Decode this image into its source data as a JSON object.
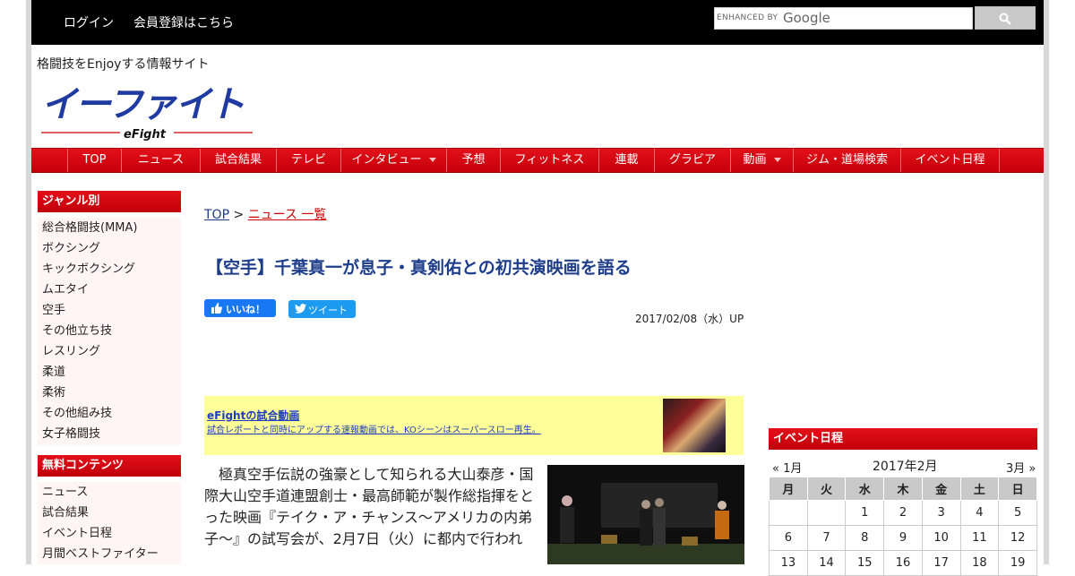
{
  "topbar": {
    "login": "ログイン",
    "register": "会員登録はこちら",
    "search_label": "ENHANCED BY",
    "search_brand": "Google"
  },
  "header": {
    "tagline": "格闘技をEnjoyする情報サイト",
    "logo_text": "イーファイト",
    "logo_sub": "eFight"
  },
  "nav": {
    "items": [
      "TOP",
      "ニュース",
      "試合結果",
      "テレビ",
      "インタビュー",
      "予想",
      "フィットネス",
      "連載",
      "グラビア",
      "動画",
      "ジム・道場検索",
      "イベント日程"
    ]
  },
  "sidebar": {
    "genre_title": "ジャンル別",
    "genre_items": [
      "総合格闘技(MMA)",
      "ボクシング",
      "キックボクシング",
      "ムエタイ",
      "空手",
      "その他立ち技",
      "レスリング",
      "柔道",
      "柔術",
      "その他組み技",
      "女子格闘技"
    ],
    "free_title": "無料コンテンツ",
    "free_items": [
      "ニュース",
      "試合結果",
      "イベント日程",
      "月間ベストファイター"
    ]
  },
  "breadcrumb": {
    "top": "TOP",
    "sep": ">",
    "list": "ニュース 一覧"
  },
  "article": {
    "title": "【空手】千葉真一が息子・真剣佑との初共演映画を語る",
    "like_label": "いいね！",
    "tweet_label": "ツイート",
    "date": "2017/02/08（水）UP",
    "body": "　極真空手伝説の強豪として知られる大山泰彦・国際大山空手道連盟創士・最高師範が製作総指揮をとった映画『テイク・ア・チャンス～アメリカの内弟子～』の試写会が、2月7日（火）に都内で行われ"
  },
  "ad": {
    "title": "eFightの試合動画",
    "desc": "試合レポートと同時にアップする速報動画では、KOシーンはスーパースロー再生。"
  },
  "event": {
    "title": "イベント日程",
    "prev": "« 1月",
    "month": "2017年2月",
    "next": "3月 »",
    "weekdays": [
      "月",
      "火",
      "水",
      "木",
      "金",
      "土",
      "日"
    ],
    "weeks": [
      [
        "",
        "",
        "1",
        "2",
        "3",
        "4",
        "5"
      ],
      [
        "6",
        "7",
        "8",
        "9",
        "10",
        "11",
        "12"
      ],
      [
        "13",
        "14",
        "15",
        "16",
        "17",
        "18",
        "19"
      ]
    ]
  },
  "colors": {
    "nav_red": "#d4000e",
    "title_blue": "#1e3d8a",
    "logo_blue": "#1f3aa0",
    "ad_yellow": "#ffff99"
  }
}
